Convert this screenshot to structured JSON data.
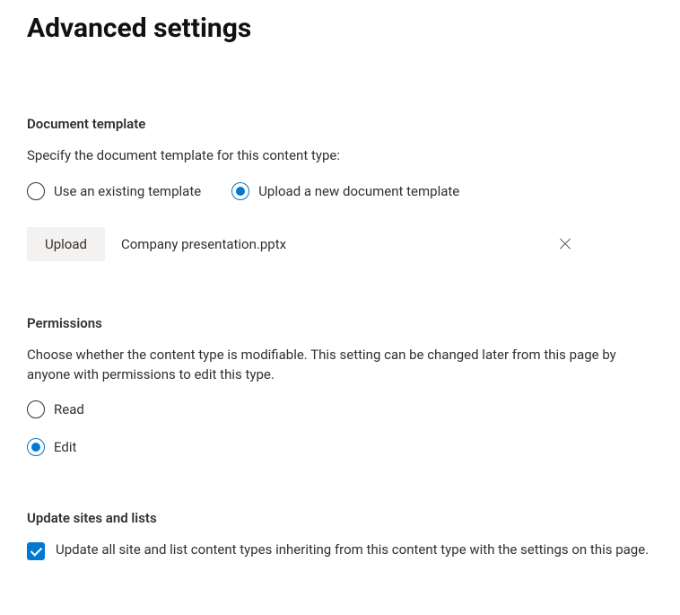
{
  "pageTitle": "Advanced settings",
  "documentTemplate": {
    "heading": "Document template",
    "description": "Specify the document template for this content type:",
    "options": {
      "existing": "Use an existing template",
      "upload": "Upload a new document template"
    },
    "selected": "upload",
    "uploadButtonLabel": "Upload",
    "uploadedFileName": "Company presentation.pptx"
  },
  "permissions": {
    "heading": "Permissions",
    "description": "Choose whether the content type is modifiable. This setting can be changed later from this page by anyone with permissions to edit this type.",
    "options": {
      "read": "Read",
      "edit": "Edit"
    },
    "selected": "edit"
  },
  "updateSites": {
    "heading": "Update sites and lists",
    "checkboxLabel": "Update all site and list content types inheriting from this content type with the settings on this page.",
    "checked": true
  }
}
